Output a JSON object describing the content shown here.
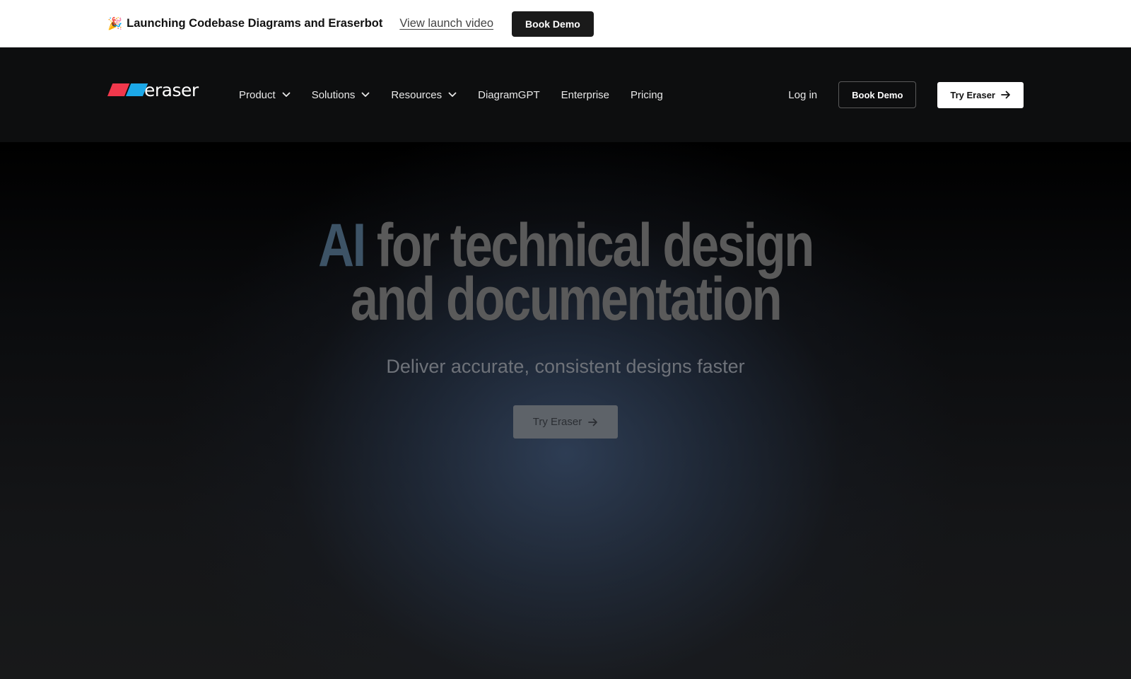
{
  "announcement": {
    "emoji": "🎉",
    "text": "Launching Codebase Diagrams and Eraserbot",
    "link": "View launch video",
    "button": "Book Demo"
  },
  "nav": {
    "logo_text": "eraser",
    "items": [
      {
        "label": "Product",
        "has_dropdown": true
      },
      {
        "label": "Solutions",
        "has_dropdown": true
      },
      {
        "label": "Resources",
        "has_dropdown": true
      },
      {
        "label": "DiagramGPT",
        "has_dropdown": false
      },
      {
        "label": "Enterprise",
        "has_dropdown": false
      },
      {
        "label": "Pricing",
        "has_dropdown": false
      }
    ],
    "login": "Log in",
    "book_demo": "Book Demo",
    "try_eraser": "Try Eraser"
  },
  "hero": {
    "title_accent": "AI",
    "title_line1_rest": " for technical design",
    "title_line2": "and documentation",
    "subtitle": "Deliver accurate, consistent designs faster",
    "cta": "Try Eraser"
  },
  "colors": {
    "logo_red": "#f0384c",
    "logo_blue": "#1ca8e8",
    "title_accent": "#3d5366"
  },
  "icons": {
    "dropdown": "chevron-down-icon",
    "cta": "arrow-right-icon",
    "announcement": "party-popper-icon"
  }
}
